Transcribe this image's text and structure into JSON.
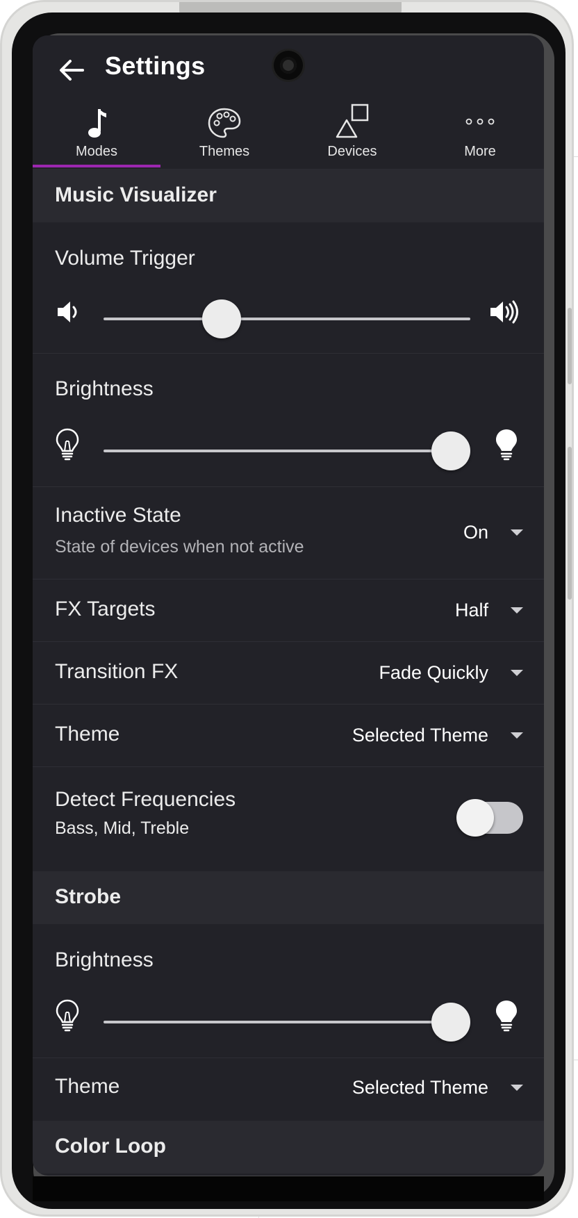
{
  "header": {
    "title": "Settings"
  },
  "tabs": [
    {
      "label": "Modes",
      "icon": "music-note-icon",
      "selected": true
    },
    {
      "label": "Themes",
      "icon": "palette-icon",
      "selected": false
    },
    {
      "label": "Devices",
      "icon": "shapes-icon",
      "selected": false
    },
    {
      "label": "More",
      "icon": "more-dots-icon",
      "selected": false
    }
  ],
  "accent_color": "#9c27b0",
  "music_visualizer": {
    "header": "Music Visualizer",
    "volume_trigger": {
      "label": "Volume Trigger",
      "level": 0.3
    },
    "brightness": {
      "label": "Brightness",
      "level": 1.0
    },
    "inactive_state": {
      "label": "Inactive State",
      "description": "State of devices when not active",
      "value": "On"
    },
    "fx_targets": {
      "label": "FX Targets",
      "value": "Half"
    },
    "transition_fx": {
      "label": "Transition FX",
      "value": "Fade Quickly"
    },
    "theme": {
      "label": "Theme",
      "value": "Selected Theme"
    },
    "detect_frequencies": {
      "label": "Detect Frequencies",
      "description": "Bass, Mid, Treble",
      "enabled": false
    }
  },
  "strobe": {
    "header": "Strobe",
    "brightness": {
      "label": "Brightness",
      "level": 1.0
    },
    "theme": {
      "label": "Theme",
      "value": "Selected Theme"
    }
  },
  "color_loop": {
    "header": "Color Loop"
  }
}
